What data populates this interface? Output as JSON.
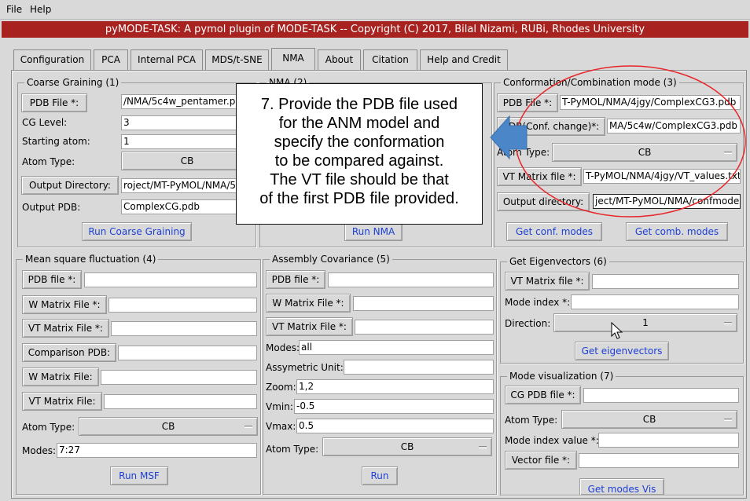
{
  "menu": {
    "file": "File",
    "help": "Help"
  },
  "window_title": "pyMODE-TASK: A pymol plugin of MODE-TASK -- Copyright (C) 2017, Bilal Nizami, RUBi, Rhodes University",
  "tabs": [
    "Configuration",
    "PCA",
    "Internal PCA",
    "MDS/t-SNE",
    "NMA",
    "About",
    "Citation",
    "Help and Credit"
  ],
  "active_tab": "NMA",
  "coarse": {
    "title": "Coarse Graining (1)",
    "pdb_button": "PDB File *:",
    "pdb_value": "/NMA/5c4w_pentamer.pdb",
    "cg_level_label": "CG Level:",
    "cg_level_value": "3",
    "start_atom_label": "Starting atom:",
    "start_atom_value": "1",
    "atom_type_label": "Atom Type:",
    "atom_type_value": "CB",
    "output_dir_button": "Output Directory:",
    "output_dir_value": "roject/MT-PyMOL/NMA/5c4w",
    "output_pdb_label": "Output PDB:",
    "output_pdb_value": "ComplexCG.pdb",
    "run_button": "Run Coarse Graining"
  },
  "nma": {
    "title": "NMA (2)",
    "run_button": "Run NMA"
  },
  "conformation": {
    "title": "Conformation/Combination mode (3)",
    "pdb_button": "PDB File *:",
    "pdb_value": "T-PyMOL/NMA/4jgy/ComplexCG3.pdb",
    "pdb_conf_button": "PDB(Conf. change)*:",
    "pdb_conf_value": "MA/5c4w/ComplexCG3.pdb",
    "atom_type_label": "Atom Type:",
    "atom_type_value": "CB",
    "vt_button": "VT Matrix file *:",
    "vt_value": "T-PyMOL/NMA/4jgy/VT_values.txt",
    "output_dir_button": "Output directory:",
    "output_dir_value": "ject/MT-PyMOL/NMA/confmodes",
    "conf_button": "Get conf. modes",
    "comb_button": "Get comb. modes"
  },
  "msf": {
    "title": "Mean square fluctuation (4)",
    "pdb_button": "PDB file *:",
    "w_button": "W Matrix File *:",
    "vt_button": "VT Matrix File *:",
    "comp_button": "Comparison PDB:",
    "w2_button": "W Matrix File:",
    "vt2_button": "VT Matrix File:",
    "atom_type_label": "Atom Type:",
    "atom_type_value": "CB",
    "modes_label": "Modes:",
    "modes_value": "7:27",
    "run_button": "Run MSF"
  },
  "assembly": {
    "title": "Assembly Covariance (5)",
    "pdb_button": "PDB file *:",
    "w_button": "W Matrix File *:",
    "vt_button": "VT Matrix File *:",
    "modes_label": "Modes:",
    "modes_value": "all",
    "asym_label": "Assymetric Unit:",
    "zoom_label": "Zoom:",
    "zoom_value": "1,2",
    "vmin_label": "Vmin:",
    "vmin_value": "-0.5",
    "vmax_label": "Vmax:",
    "vmax_value": "0.5",
    "atom_type_label": "Atom Type:",
    "atom_type_value": "CB",
    "run_button": "Run"
  },
  "eigen": {
    "title": "Get Eigenvectors (6)",
    "vt_button": "VT Matrix file *:",
    "mode_index_label": "Mode index *:",
    "direction_label": "Direction:",
    "direction_value": "1",
    "get_button": "Get eigenvectors"
  },
  "modevis": {
    "title": "Mode visualization (7)",
    "cg_button": "CG PDB file *:",
    "atom_type_label": "Atom Type:",
    "atom_type_value": "CB",
    "mode_index_label": "Mode index value *:",
    "vector_button": "Vector file *:",
    "get_button": "Get modes Vis"
  },
  "callout_lines": [
    "7. Provide the PDB file used",
    "for the ANM model and",
    "specify the conformation",
    "to be compared against.",
    "The VT file should be that",
    "of the first PDB file provided."
  ],
  "colors": {
    "title_bar": "#a8221f",
    "annotation": "#e8262a",
    "arrow": "#4a86c8",
    "link_button_text": "#1c3fd6"
  }
}
